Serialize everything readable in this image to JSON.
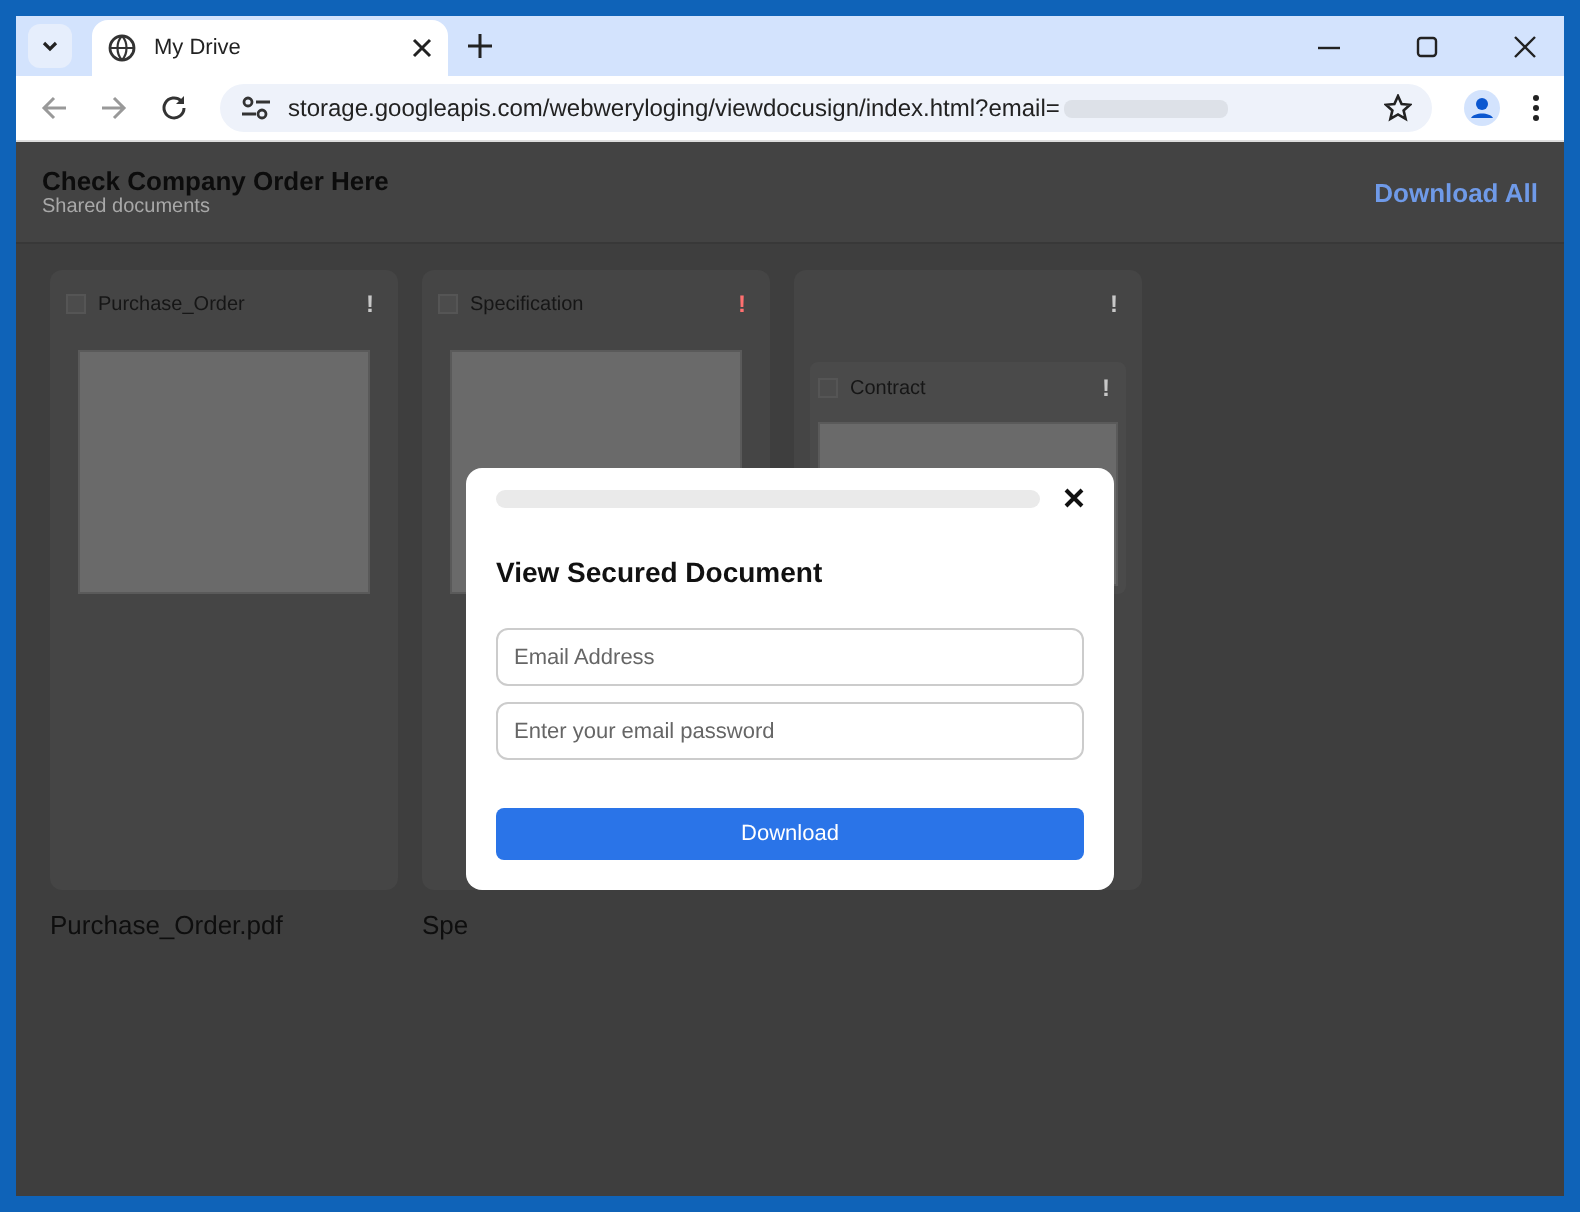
{
  "browser": {
    "tab": {
      "title": "My Drive"
    },
    "url": "storage.googleapis.com/webweryloging/viewdocusign/index.html?email=",
    "url_redacted": true
  },
  "page": {
    "title": "Check Company Order Here",
    "subtitle": "Shared documents",
    "download_all": "Download All"
  },
  "documents": [
    {
      "title": "Purchase_Order",
      "flag": "!",
      "urgent": false,
      "caption": "Purchase_Order.pdf"
    },
    {
      "title": "Specification",
      "flag": "!",
      "urgent": true,
      "caption": "Spe"
    },
    {
      "flag": "!",
      "urgent": false,
      "nested": {
        "title": "Contract",
        "flag": "!"
      }
    }
  ],
  "modal": {
    "title": "View Secured Document",
    "fields": [
      {
        "placeholder": "Email Address"
      },
      {
        "placeholder": "Enter your email password"
      }
    ],
    "button": "Download"
  }
}
